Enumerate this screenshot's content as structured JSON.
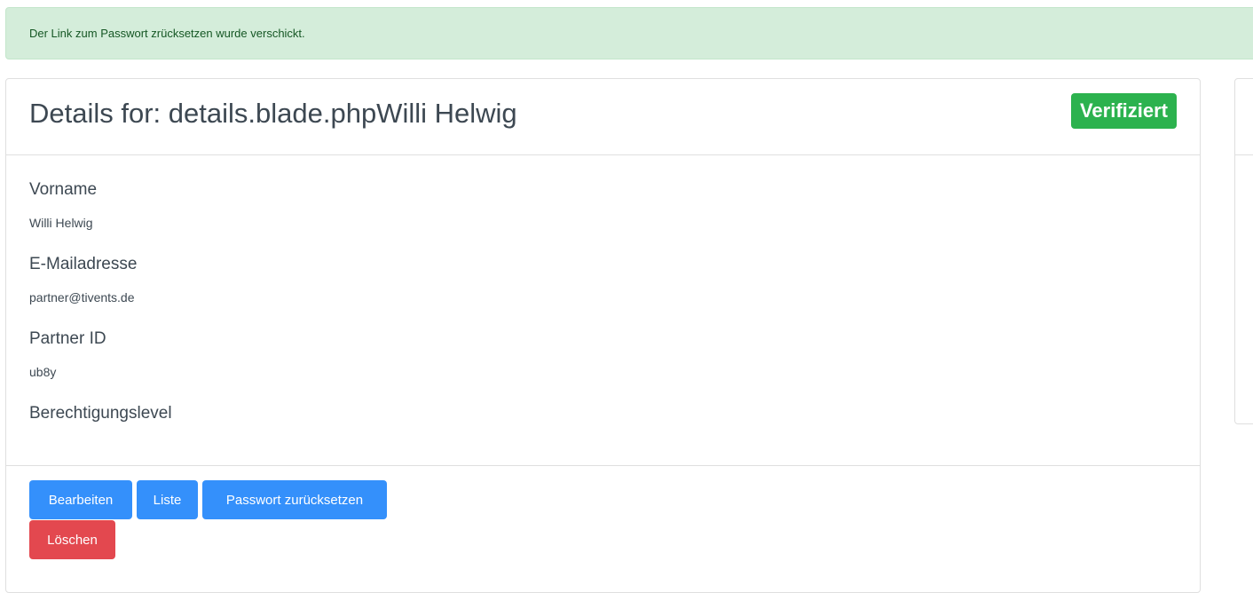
{
  "alert": {
    "message": "Der Link zum Passwort zrücksetzen wurde verschickt."
  },
  "details": {
    "title": "Details for: details.blade.phpWilli Helwig",
    "status_badge": "Verifiziert",
    "fields": [
      {
        "label": "Vorname",
        "value": "Willi Helwig"
      },
      {
        "label": "E-Mailadresse",
        "value": "partner@tivents.de"
      },
      {
        "label": "Partner ID",
        "value": "ub8y"
      },
      {
        "label": "Berechtigungslevel",
        "value": ""
      }
    ]
  },
  "actions": {
    "edit": "Bearbeiten",
    "list": "Liste",
    "reset_password": "Passwort zurücksetzen",
    "delete": "Löschen"
  },
  "colors": {
    "alert_bg": "#d4edda",
    "success_badge": "#2cb24e",
    "primary": "#3490fb",
    "danger": "#e3484f"
  }
}
